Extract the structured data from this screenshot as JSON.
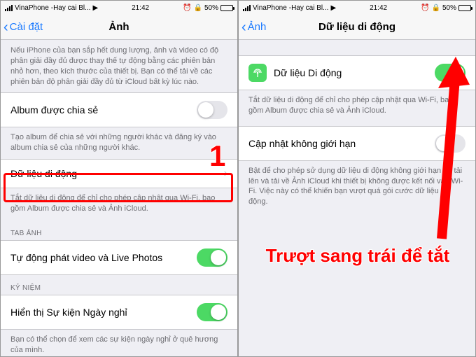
{
  "statusbar": {
    "carrier": "VinaPhone",
    "nowplaying": "-Hay cai Bl...",
    "time": "21:42",
    "battery_pct": "50%"
  },
  "left": {
    "back": "Cài đặt",
    "title": "Ảnh",
    "intro": "Nếu iPhone của bạn sắp hết dung lượng, ảnh và video có độ phân giải đầy đủ được thay thế tự động bằng các phiên bản nhỏ hơn, theo kích thước của thiết bị. Bạn có thể tải về các phiên bản độ phân giải đầy đủ từ iCloud bất kỳ lúc nào.",
    "row_shared_album": "Album được chia sẻ",
    "shared_desc": "Tạo album để chia sẻ với những người khác và đăng ký vào album chia sẻ của những người khác.",
    "row_cellular": "Dữ liệu di động",
    "cellular_desc": "Tắt dữ liệu di động để chỉ cho phép cập nhật qua Wi-Fi, bao gồm Album được chia sẻ và Ảnh iCloud.",
    "section_tab": "TAB ẢNH",
    "row_autoplay": "Tự động phát video và Live Photos",
    "section_memories": "KỶ NIỆM",
    "row_holiday": "Hiển thị Sự kiện Ngày nghỉ",
    "holiday_desc": "Bạn có thể chọn để xem các sự kiện ngày nghỉ ở quê hương của mình."
  },
  "right": {
    "back": "Ảnh",
    "title": "Dữ liệu di động",
    "row_cellular": "Dữ liệu Di động",
    "cellular_desc": "Tắt dữ liệu di động để chỉ cho phép cập nhật qua Wi-Fi, bao gồm Album được chia sẻ và Ảnh iCloud.",
    "row_unlimited": "Cập nhật không giới hạn",
    "unlimited_desc": "Bật để cho phép sử dụng dữ liệu di động không giới hạn để tải lên và tải về Ảnh iCloud khi thiết bị không được kết nối vào Wi-Fi. Việc này có thể khiến bạn vượt quá gói cước dữ liệu di động."
  },
  "annotations": {
    "step1": "1",
    "instruction": "Trượt sang trái để tắt"
  },
  "colors": {
    "annotation": "#ff0000",
    "toggle_on": "#4cd964",
    "link": "#1a7aff"
  }
}
